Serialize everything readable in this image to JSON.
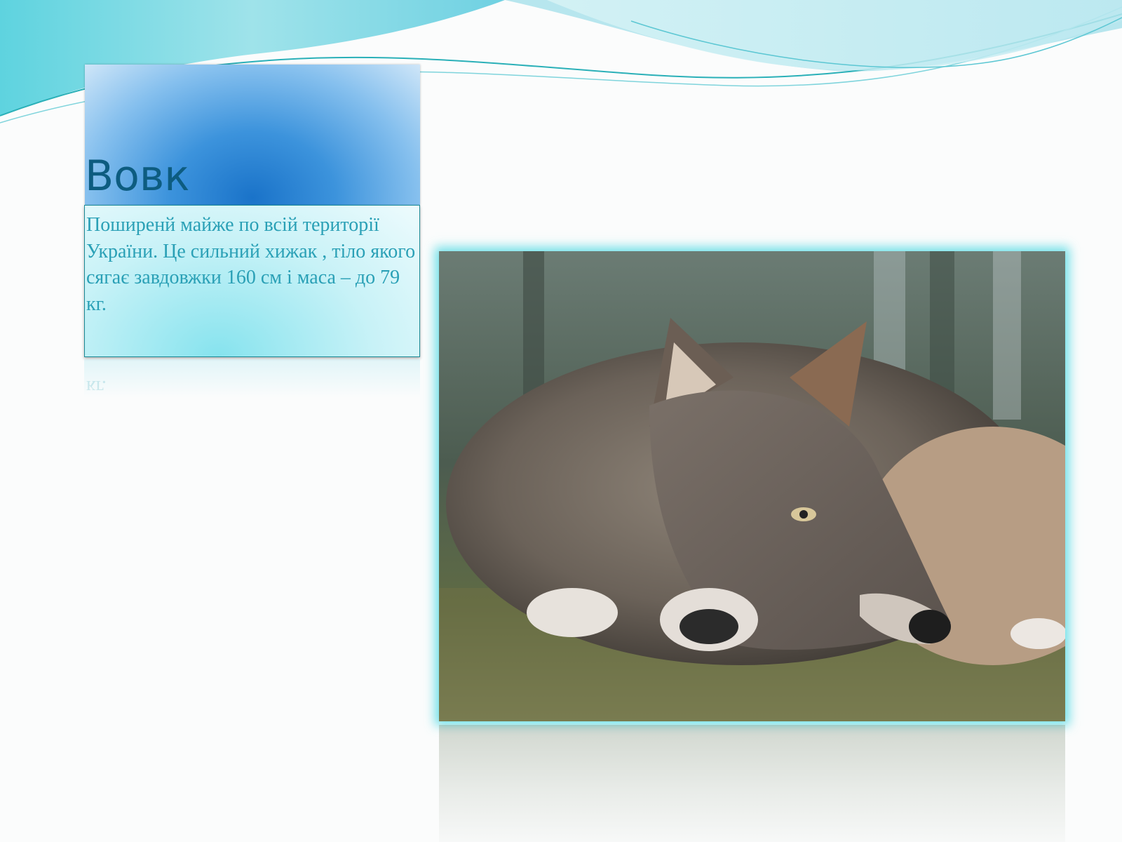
{
  "slide": {
    "title": "Вовк",
    "body": "Поширенй  майже по всій території України. Це сильний хижак , тіло якого сягає завдовжки 160 см і маса – до 79 кг.",
    "reflection_fragment": "кг."
  },
  "image": {
    "subject": "wolf-lying-on-ground"
  },
  "colors": {
    "title": "#0d5c80",
    "body_text": "#2aa0b6",
    "title_box": "#3c93dc",
    "body_box": "#c8f2f7",
    "photo_glow": "#46d7e1"
  }
}
